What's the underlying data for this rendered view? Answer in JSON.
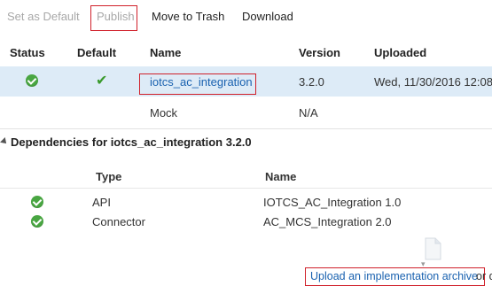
{
  "toolbar": {
    "set_default": "Set as Default",
    "publish": "Publish",
    "move_to_trash": "Move to Trash",
    "download": "Download"
  },
  "table": {
    "headers": {
      "status": "Status",
      "default": "Default",
      "name": "Name",
      "version": "Version",
      "uploaded": "Uploaded"
    },
    "rows": [
      {
        "name": "iotcs_ac_integration",
        "version": "3.2.0",
        "uploaded": "Wed, 11/30/2016 12:08"
      },
      {
        "name": "Mock",
        "version": "N/A",
        "uploaded": ""
      }
    ]
  },
  "dependencies": {
    "title": "Dependencies for iotcs_ac_integration 3.2.0",
    "headers": {
      "type": "Type",
      "name": "Name"
    },
    "rows": [
      {
        "type": "API",
        "name": "IOTCS_AC_Integration 1.0"
      },
      {
        "type": "Connector",
        "name": "AC_MCS_Integration 2.0"
      }
    ]
  },
  "upload": {
    "link": "Upload an implementation archive",
    "trailing": "or d"
  },
  "colors": {
    "accent_red": "#d0202a",
    "link_blue": "#1a62b0",
    "selected_row": "#ddebf7",
    "status_green": "#49a642"
  }
}
